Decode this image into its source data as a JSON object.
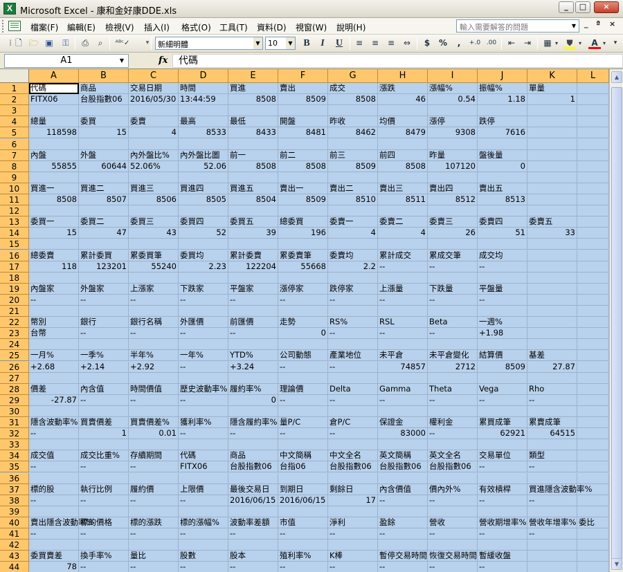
{
  "window": {
    "app_title": "Microsoft Excel - 康和金好康DDE.xls",
    "app_icon_letter": "X",
    "minimize_label": "_",
    "restore_label": "□",
    "close_label": "×"
  },
  "menubar": {
    "items": [
      "檔案(F)",
      "編輯(E)",
      "檢視(V)",
      "插入(I)",
      "格式(O)",
      "工具(T)",
      "資料(D)",
      "視窗(W)",
      "說明(H)"
    ],
    "help_placeholder": "輸入需要解答的問題",
    "doc_minimize": "_",
    "doc_restore": "ª",
    "doc_close": "×"
  },
  "toolbar": {
    "font_name": "新細明體",
    "font_size": "10",
    "bold": "B",
    "italic": "I",
    "underline": "U",
    "currency": "$",
    "percent": "%",
    "thousands": ",",
    "increase_decimal": "+.0",
    "decrease_decimal": ".00",
    "font_color_letter": "A"
  },
  "formula_bar": {
    "cell_ref": "A1",
    "fx_label": "fx",
    "content": "代碼"
  },
  "sheet": {
    "columns": [
      "A",
      "B",
      "C",
      "D",
      "E",
      "F",
      "G",
      "H",
      "I",
      "J",
      "K",
      "L"
    ],
    "row_numbers": [
      "1",
      "2",
      "3",
      "4",
      "5",
      "6",
      "7",
      "8",
      "9",
      "10",
      "11",
      "12",
      "13",
      "14",
      "15",
      "16",
      "17",
      "18",
      "19",
      "20",
      "21",
      "22",
      "23",
      "24",
      "25",
      "26",
      "27",
      "28",
      "29",
      "30",
      "31",
      "32",
      "33",
      "34",
      "35",
      "36",
      "37",
      "38",
      "39",
      "40",
      "41",
      "42",
      "43",
      "44"
    ],
    "rows": [
      [
        "代碼",
        "商品",
        "交易日期",
        "時間",
        "買進",
        "賣出",
        "成交",
        "漲跌",
        "漲幅%",
        "振幅%",
        "單量",
        ""
      ],
      [
        "FITX06",
        "台股指數06",
        "2016/05/30",
        "13:44:59",
        "8508",
        "8509",
        "8508",
        "46",
        "0.54",
        "1.18",
        "1",
        ""
      ],
      [],
      [
        "總量",
        "委買",
        "委賣",
        "最高",
        "最低",
        "開盤",
        "昨收",
        "均價",
        "漲停",
        "跌停",
        "",
        ""
      ],
      [
        "118598",
        "15",
        "4",
        "8533",
        "8433",
        "8481",
        "8462",
        "8479",
        "9308",
        "7616",
        "",
        ""
      ],
      [],
      [
        "內盤",
        "外盤",
        "內外盤比%",
        "內外盤比圖",
        "前一",
        "前二",
        "前三",
        "前四",
        "昨量",
        "盤後量",
        "",
        ""
      ],
      [
        "55855",
        "60644",
        "52.06%",
        "52.06",
        "8508",
        "8508",
        "8509",
        "8508",
        "107120",
        "0",
        "",
        ""
      ],
      [],
      [
        "買進一",
        "買進二",
        "買進三",
        "買進四",
        "買進五",
        "賣出一",
        "賣出二",
        "賣出三",
        "賣出四",
        "賣出五",
        "",
        ""
      ],
      [
        "8508",
        "8507",
        "8506",
        "8505",
        "8504",
        "8509",
        "8510",
        "8511",
        "8512",
        "8513",
        "",
        ""
      ],
      [],
      [
        "委買一",
        "委買二",
        "委買三",
        "委買四",
        "委買五",
        "總委買",
        "委賣一",
        "委賣二",
        "委賣三",
        "委賣四",
        "委賣五",
        ""
      ],
      [
        "15",
        "47",
        "43",
        "52",
        "39",
        "196",
        "4",
        "4",
        "26",
        "51",
        "33",
        ""
      ],
      [],
      [
        "總委賣",
        "累計委買",
        "累委買筆",
        "委買均",
        "累計委賣",
        "累委賣筆",
        "委賣均",
        "累計成交",
        "累成交筆",
        "成交均",
        "",
        ""
      ],
      [
        "118",
        "123201",
        "55240",
        "2.23",
        "122204",
        "55668",
        "2.2",
        "--",
        "--",
        "--",
        "",
        ""
      ],
      [],
      [
        "內盤家",
        "外盤家",
        "上漲家",
        "下跌家",
        "平盤家",
        "漲停家",
        "跌停家",
        "上漲量",
        "下跌量",
        "平盤量",
        "",
        ""
      ],
      [
        "--",
        "--",
        "--",
        "--",
        "--",
        "--",
        "--",
        "--",
        "--",
        "--",
        "",
        ""
      ],
      [],
      [
        "幣別",
        "銀行",
        "銀行名稱",
        "外匯價",
        "前匯價",
        "走勢",
        "RS%",
        "RSL",
        "Beta",
        "一週%",
        "",
        ""
      ],
      [
        "台幣",
        "--",
        "--",
        "--",
        "--",
        "0",
        "--",
        "--",
        "--",
        "+1.98",
        "",
        ""
      ],
      [],
      [
        "一月%",
        "一季%",
        "半年%",
        "一年%",
        "YTD%",
        "公司動態",
        "產業地位",
        "未平倉",
        "未平倉變化",
        "結算價",
        "基差",
        ""
      ],
      [
        "+2.68",
        "+2.14",
        "+2.92",
        "--",
        "+3.24",
        "--",
        "--",
        "74857",
        "2712",
        "8509",
        "27.87",
        ""
      ],
      [],
      [
        "價差",
        "內含值",
        "時間價值",
        "歷史波動率%",
        "履約率%",
        "理論價",
        "Delta",
        "Gamma",
        "Theta",
        "Vega",
        "Rho",
        ""
      ],
      [
        "-27.87",
        "--",
        "--",
        "--",
        "0",
        "--",
        "--",
        "--",
        "--",
        "--",
        "--",
        ""
      ],
      [],
      [
        "隱含波動率%",
        "買賣價差",
        "買賣價差%",
        "獲利率%",
        "隱含履約率%",
        "量P/C",
        "倉P/C",
        "保證金",
        "權利金",
        "累買成筆",
        "累賣成筆",
        ""
      ],
      [
        "--",
        "1",
        "0.01",
        "--",
        "--",
        "--",
        "--",
        "83000",
        "--",
        "62921",
        "64515",
        ""
      ],
      [],
      [
        "成交值",
        "成交比重%",
        "存續期間",
        "代碼",
        "商品",
        "中文簡稱",
        "中文全名",
        "英文簡稱",
        "英文全名",
        "交易單位",
        "類型",
        ""
      ],
      [
        "--",
        "--",
        "--",
        "FITX06",
        "台股指數06",
        "台指06",
        "台股指數06",
        "台股指數06",
        "台股指數06",
        "--",
        "--",
        ""
      ],
      [],
      [
        "標的股",
        "執行比例",
        "履約價",
        "上限價",
        "最後交易日",
        "到期日",
        "剩餘日",
        "內含價值",
        "價內外%",
        "有效槓桿",
        "買進隱含波動率%",
        ""
      ],
      [
        "--",
        "--",
        "--",
        "--",
        "2016/06/15",
        "2016/06/15",
        "17",
        "--",
        "--",
        "--",
        "--",
        ""
      ],
      [],
      [
        "賣出隱含波動率%",
        "標的價格",
        "標的漲跌",
        "標的漲幅%",
        "波動率差額",
        "市值",
        "淨利",
        "盈餘",
        "營收",
        "營收期增率%",
        "營收年增率%",
        "委比"
      ],
      [
        "--",
        "--",
        "--",
        "--",
        "--",
        "--",
        "--",
        "--",
        "--",
        "--",
        "--",
        ""
      ],
      [],
      [
        "委買賣差",
        "換手率%",
        "量比",
        "股數",
        "股本",
        "殖利率%",
        "K棒",
        "暫停交易時間",
        "恢復交易時間",
        "暫緩收盤",
        "",
        ""
      ],
      [
        "78",
        "--",
        "--",
        "--",
        "--",
        "--",
        "--",
        "--",
        "--",
        "--",
        "",
        ""
      ]
    ]
  },
  "colors": {
    "header_orange": "#ffc76b",
    "grid_fill": "#b8d1ec",
    "active_cell": "#ffffff"
  }
}
